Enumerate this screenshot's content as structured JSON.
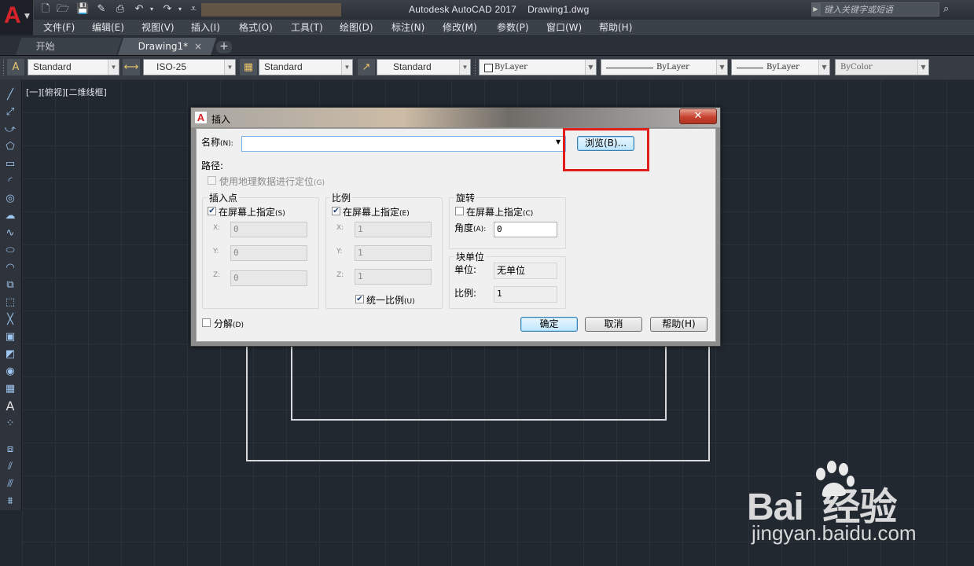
{
  "app": {
    "logo_letter": "A",
    "title": "Autodesk AutoCAD 2017    Drawing1.dwg",
    "search_placeholder": "键入关键字或短语"
  },
  "menu": [
    "文件(F)",
    "编辑(E)",
    "视图(V)",
    "插入(I)",
    "格式(O)",
    "工具(T)",
    "绘图(D)",
    "标注(N)",
    "修改(M)",
    "参数(P)",
    "窗口(W)",
    "帮助(H)"
  ],
  "tabs": [
    {
      "label": "开始",
      "active": false
    },
    {
      "label": "Drawing1*",
      "active": true
    }
  ],
  "tab_close": "×",
  "tab_add": "+",
  "styles": {
    "text_style": "Standard",
    "dim_style": "ISO-25",
    "table_style": "Standard",
    "mleader_style": "Standard",
    "color": "ByLayer",
    "linetype": "ByLayer",
    "lineweight": "ByLayer",
    "plotstyle": "ByColor"
  },
  "viewport_label": "[一][俯视][二维线框]",
  "dialog": {
    "title": "插入",
    "close": "✕",
    "name_label": "名称",
    "name_key": "(N):",
    "name_value": "",
    "browse_button": "浏览(B)...",
    "path_label": "路径:",
    "geo_checkbox": "使用地理数据进行定位",
    "geo_key": "(G)",
    "insertion": {
      "title": "插入点",
      "specify": "在屏幕上指定",
      "specify_key": "(S)",
      "specify_checked": true,
      "x_label": "X:",
      "x_value": "0",
      "y_label": "Y:",
      "y_value": "0",
      "z_label": "Z:",
      "z_value": "0"
    },
    "scale": {
      "title": "比例",
      "specify": "在屏幕上指定",
      "specify_key": "(E)",
      "specify_checked": true,
      "x_label": "X:",
      "x_value": "1",
      "y_label": "Y:",
      "y_value": "1",
      "z_label": "Z:",
      "z_value": "1",
      "uniform": "统一比例",
      "uniform_key": "(U)",
      "uniform_checked": true
    },
    "rotation": {
      "title": "旋转",
      "specify": "在屏幕上指定",
      "specify_key": "(C)",
      "specify_checked": false,
      "angle_label": "角度",
      "angle_key": "(A):",
      "angle_value": "0"
    },
    "block_unit": {
      "title": "块单位",
      "unit_label": "单位:",
      "unit_value": "无单位",
      "factor_label": "比例:",
      "factor_value": "1"
    },
    "explode": "分解",
    "explode_key": "(D)",
    "explode_checked": false,
    "ok": "确定",
    "cancel": "取消",
    "help": "帮助(H)"
  },
  "watermark": {
    "brand": "Bai  经验",
    "url": "jingyan.baidu.com"
  },
  "colors": {
    "canvas_bg": "#212830",
    "highlight": "#e21b1b",
    "logo_red": "#d8232a"
  }
}
